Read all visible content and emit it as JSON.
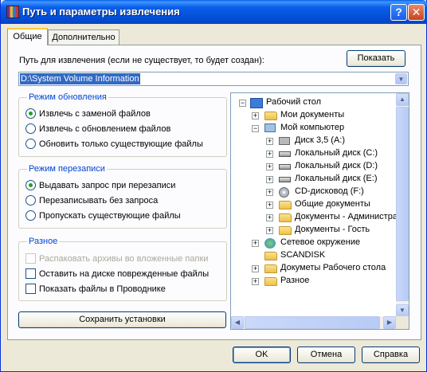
{
  "window": {
    "title": "Путь и параметры извлечения"
  },
  "title_buttons": {
    "help": "?",
    "close": "✕"
  },
  "tabs": [
    {
      "label": "Общие",
      "active": true
    },
    {
      "label": "Дополнительно",
      "active": false
    }
  ],
  "path": {
    "label": "Путь для извлечения (если не существует, то будет создан):",
    "show_button": "Показать",
    "value": "D:\\System Volume Information"
  },
  "update_mode": {
    "title": "Режим обновления",
    "options": [
      {
        "label": "Извлечь с заменой файлов",
        "checked": true
      },
      {
        "label": "Извлечь с обновлением файлов",
        "checked": false
      },
      {
        "label": "Обновить только существующие файлы",
        "checked": false
      }
    ]
  },
  "overwrite_mode": {
    "title": "Режим перезаписи",
    "options": [
      {
        "label": "Выдавать запрос при перезаписи",
        "checked": true
      },
      {
        "label": "Перезаписывать без запроса",
        "checked": false
      },
      {
        "label": "Пропускать существующие файлы",
        "checked": false
      }
    ]
  },
  "misc": {
    "title": "Разное",
    "options": [
      {
        "label": "Распаковать архивы во вложенные папки",
        "checked": false,
        "disabled": true
      },
      {
        "label": "Оставить на диске поврежденные файлы",
        "checked": false,
        "disabled": false
      },
      {
        "label": "Показать файлы в Проводнике",
        "checked": false,
        "disabled": false
      }
    ]
  },
  "save_button": "Сохранить установки",
  "tree": [
    {
      "label": "Рабочий стол",
      "expander": "−",
      "icon": "desktop-icon"
    },
    {
      "label": "Мои документы",
      "expander": "+",
      "icon": "folder-icon"
    },
    {
      "label": "Мой компьютер",
      "expander": "−",
      "icon": "computer-icon"
    },
    {
      "label": "Диск 3,5 (A:)",
      "expander": "+",
      "icon": "floppy-icon"
    },
    {
      "label": "Локальный диск (C:)",
      "expander": "+",
      "icon": "drive-icon"
    },
    {
      "label": "Локальный диск (D:)",
      "expander": "+",
      "icon": "drive-icon"
    },
    {
      "label": "Локальный диск (E:)",
      "expander": "+",
      "icon": "drive-icon"
    },
    {
      "label": "CD-дисковод (F:)",
      "expander": "+",
      "icon": "cd-icon"
    },
    {
      "label": "Общие документы",
      "expander": "+",
      "icon": "folder-icon"
    },
    {
      "label": "Документы - Администратор",
      "expander": "+",
      "icon": "folder-icon"
    },
    {
      "label": "Документы - Гость",
      "expander": "+",
      "icon": "folder-icon"
    },
    {
      "label": "Сетевое окружение",
      "expander": "+",
      "icon": "network-icon"
    },
    {
      "label": "SCANDISK",
      "expander": "",
      "icon": "folder-icon"
    },
    {
      "label": "Докуметы Рабочего стола",
      "expander": "+",
      "icon": "folder-icon"
    },
    {
      "label": "Разное",
      "expander": "+",
      "icon": "folder-icon"
    }
  ],
  "footer": {
    "ok": "OK",
    "cancel": "Отмена",
    "help": "Справка"
  }
}
